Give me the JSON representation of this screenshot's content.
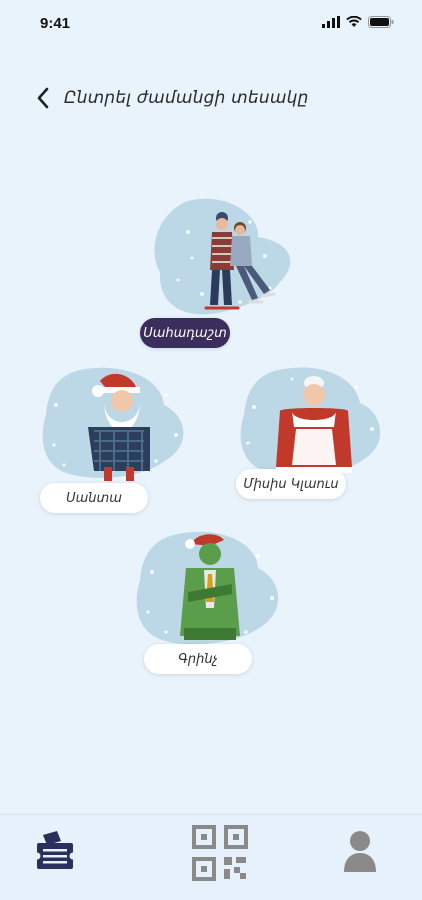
{
  "status_bar": {
    "time": "9:41"
  },
  "header": {
    "title": "Ընտրել ժամանցի տեսակը"
  },
  "characters": [
    {
      "id": "skating",
      "label": "Սահադաշտ",
      "selected": true
    },
    {
      "id": "santa",
      "label": "Սանտա",
      "selected": false
    },
    {
      "id": "mrs-claus",
      "label": "Միսիս Կլաուս",
      "selected": false
    },
    {
      "id": "grinch",
      "label": "Գրինչ",
      "selected": false
    }
  ],
  "bottom_nav": {
    "items": [
      {
        "icon": "tickets-icon",
        "active": true
      },
      {
        "icon": "qr-code-icon",
        "active": false
      },
      {
        "icon": "profile-icon",
        "active": false
      }
    ]
  },
  "colors": {
    "background": "#e8f3fc",
    "blob": "#bcd7e6",
    "accent_dark": "#3b2d5c",
    "nav_active": "#2c2f5e",
    "nav_inactive": "#8a8a8a"
  }
}
